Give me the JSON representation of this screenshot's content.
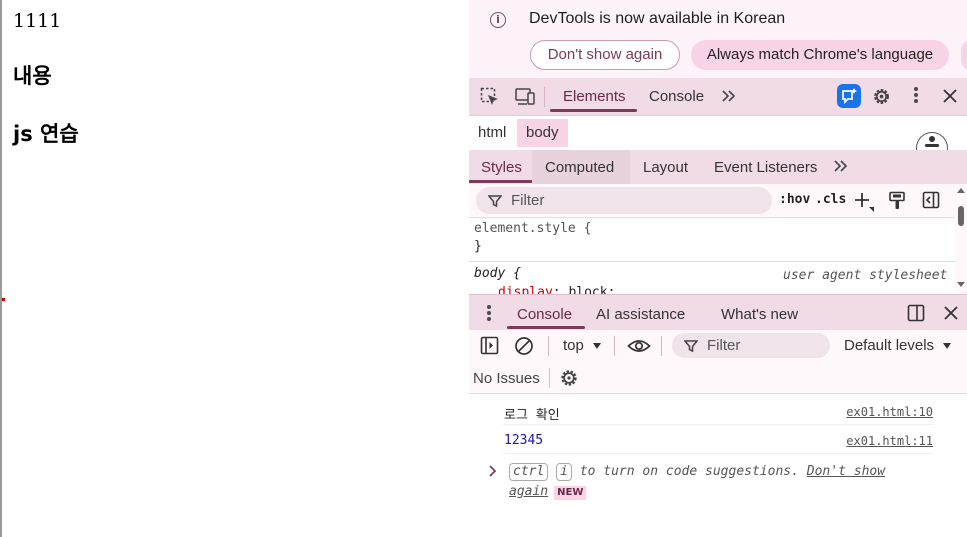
{
  "page": {
    "line1": "1111",
    "heading1": "내용",
    "heading2": "js 연습"
  },
  "devtools": {
    "infobar": {
      "message": "DevTools is now available in Korean",
      "dont_show": "Don't show again",
      "match_language": "Always match Chrome's language"
    },
    "main_tabs": [
      "Elements",
      "Console"
    ],
    "breadcrumbs": [
      "html",
      "body"
    ],
    "sub_tabs": [
      "Styles",
      "Computed",
      "Layout",
      "Event Listeners"
    ],
    "styles_filter": {
      "placeholder": "Filter",
      "hov": ":hov",
      "cls": ".cls"
    },
    "styles": {
      "element_style_open": "element.style {",
      "element_style_close": "}",
      "body_rule": "body {",
      "body_source": "user agent stylesheet",
      "property": "display",
      "value": ": block;"
    },
    "drawer_tabs": [
      "Console",
      "AI assistance",
      "What's new"
    ],
    "console_toolbar": {
      "context": "top",
      "filter_placeholder": "Filter",
      "levels": "Default levels"
    },
    "issues": "No Issues",
    "console_messages": [
      {
        "text": "로그 확인",
        "source": "ex01.html:10"
      },
      {
        "text": "12345",
        "source": "ex01.html:11"
      }
    ],
    "hint": {
      "key1": "ctrl",
      "key2": "i",
      "text": "to turn on code suggestions.",
      "link": "Don't show again",
      "badge": "NEW"
    }
  },
  "colors": {
    "accent": "#7d3b5c",
    "tab_bar": "#f1dbe6",
    "pill": "#f9d4e7",
    "number": "#1a1aa6",
    "css_property": "#c80000"
  }
}
